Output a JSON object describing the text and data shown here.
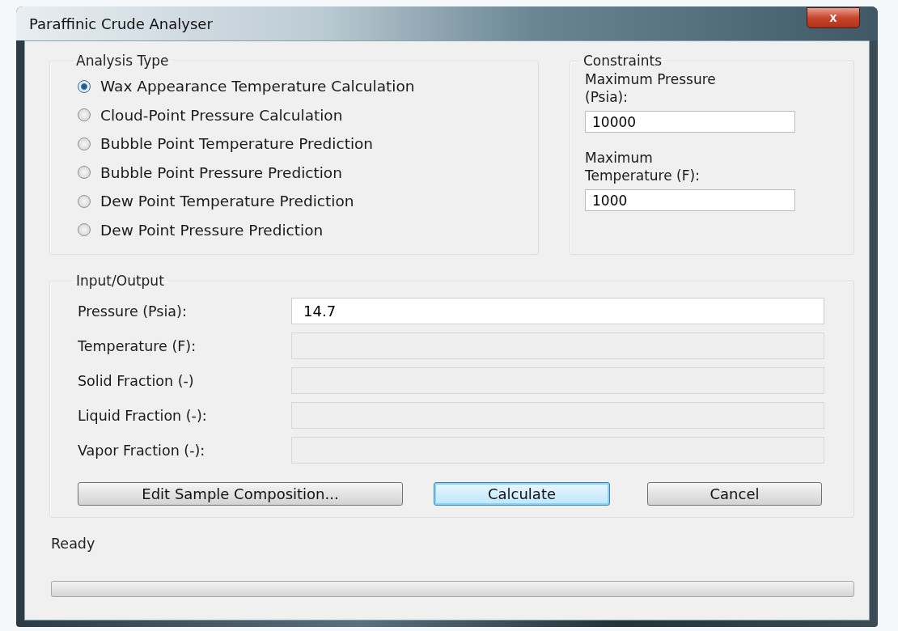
{
  "window": {
    "title": "Paraffinic Crude Analyser",
    "close_label": "x"
  },
  "analysis_type": {
    "title": "Analysis Type",
    "options": [
      {
        "label": "Wax Appearance Temperature Calculation",
        "selected": true
      },
      {
        "label": "Cloud-Point Pressure Calculation",
        "selected": false
      },
      {
        "label": "Bubble Point Temperature Prediction",
        "selected": false
      },
      {
        "label": "Bubble Point Pressure Prediction",
        "selected": false
      },
      {
        "label": "Dew Point Temperature Prediction",
        "selected": false
      },
      {
        "label": "Dew Point Pressure Prediction",
        "selected": false
      }
    ]
  },
  "constraints": {
    "title": "Constraints",
    "fields": [
      {
        "label": "Maximum Pressure (Psia):",
        "value": "10000"
      },
      {
        "label": "Maximum Temperature (F):",
        "value": "1000"
      }
    ]
  },
  "input_output": {
    "title": "Input/Output",
    "fields": [
      {
        "label": "Pressure (Psia):",
        "value": "14.7",
        "disabled": false
      },
      {
        "label": "Temperature (F):",
        "disabled": true
      },
      {
        "label": "Solid Fraction (-)",
        "disabled": true
      },
      {
        "label": "Liquid Fraction (-):",
        "disabled": true
      },
      {
        "label": "Vapor Fraction (-):",
        "disabled": true
      }
    ]
  },
  "buttons": [
    {
      "label": "Edit Sample Composition...",
      "default": false
    },
    {
      "label": "Calculate",
      "default": true
    },
    {
      "label": "Cancel",
      "default": false
    }
  ],
  "status_bar": {
    "text": "Ready",
    "progress": {
      "level": 0
    }
  }
}
